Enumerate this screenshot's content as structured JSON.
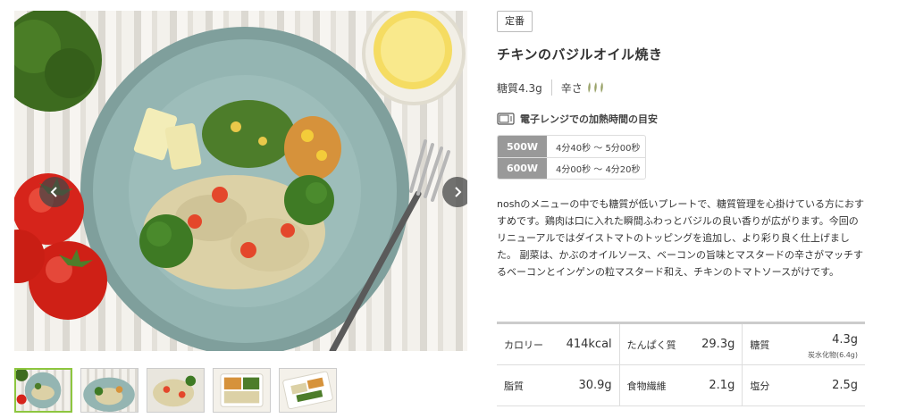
{
  "gallery": {
    "prev_label": "‹",
    "next_label": "›",
    "thumbnails": [
      {
        "kind": "plate",
        "active": true
      },
      {
        "kind": "plate",
        "active": false
      },
      {
        "kind": "plate",
        "active": false
      },
      {
        "kind": "tray",
        "active": false
      },
      {
        "kind": "tray",
        "active": false
      }
    ]
  },
  "product": {
    "badge": "定番",
    "title": "チキンのバジルオイル焼き",
    "carbs": "糖質4.3g",
    "spice_label": "辛さ",
    "spice_icon": "chili-icon",
    "spice_level": 3,
    "microwave_heading": "電子レンジでの加熱時間の目安",
    "microwave": [
      {
        "watt": "500W",
        "time": "4分40秒 ～ 5分00秒"
      },
      {
        "watt": "600W",
        "time": "4分00秒 ～ 4分20秒"
      }
    ],
    "description": "noshのメニューの中でも糖質が低いプレートで、糖質管理を心掛けている方におすすめです。鶏肉は口に入れた瞬間ふわっとバジルの良い香りが広がります。今回のリニューアルではダイストマトのトッピングを追加し、より彩り良く仕上げました。 副菜は、かぶのオイルソース、ベーコンの旨味とマスタードの辛さがマッチするベーコンとインゲンの粒マスタード和え、チキンのトマトソースがけです。"
  },
  "nutrition": {
    "rows": [
      [
        {
          "label": "カロリー",
          "value": "414kcal"
        },
        {
          "label": "たんぱく質",
          "value": "29.3g"
        },
        {
          "label": "糖質",
          "value": "4.3g",
          "sub": "炭水化物(6.4g)"
        }
      ],
      [
        {
          "label": "脂質",
          "value": "30.9g"
        },
        {
          "label": "食物繊維",
          "value": "2.1g"
        },
        {
          "label": "塩分",
          "value": "2.5g"
        }
      ]
    ]
  },
  "colors": {
    "accent_green": "#8dc63f",
    "plate": "#8fb0ad",
    "watt_bg": "#999999",
    "chili": "#9aa36a"
  }
}
